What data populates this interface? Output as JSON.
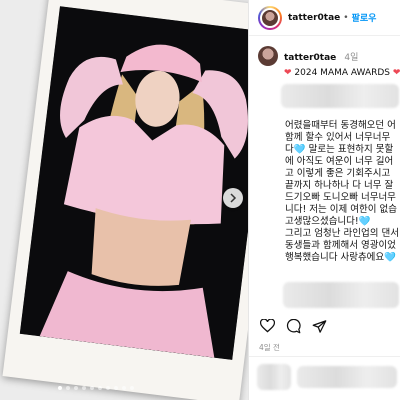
{
  "post_header": {
    "username": "tatter0tae",
    "separator": "•",
    "follow_label": "팔로우"
  },
  "caption_header": {
    "username": "tatter0tae",
    "time": "4일",
    "first_line_text": "2024 MAMA AWARDS"
  },
  "caption_lines": [
    "어렸을때부터 동경해오던 어",
    "함께 할수 있어서 너무너무",
    "다🩵 말로는 표현하지 못할",
    "에 아직도 여운이 너무 길어",
    "고 이렇게 좋은 기회주시고",
    "끝까지 하나하나 다 너무 잘",
    "드기오빠 도니오빠 너무너무",
    "니다! 저는 이제 여한이 없습",
    "고생많으셨습니다!🩵",
    "그리고 엄청난 라인업의 댄서",
    "동생들과 함께해서 영광이었",
    "행복했습니다 사랑츄에요🩵"
  ],
  "post_date": "4일 전",
  "carousel": {
    "count": 10,
    "active": 0
  },
  "icons": {
    "like": "heart-outline-icon",
    "comment": "comment-bubble-icon",
    "share": "paper-plane-icon",
    "save": "bookmark-icon",
    "next": "chevron-right-icon"
  },
  "colors": {
    "link_blue": "#0095f6",
    "heart_red": "#ed4956",
    "secondary_text": "#8e8e8e"
  }
}
